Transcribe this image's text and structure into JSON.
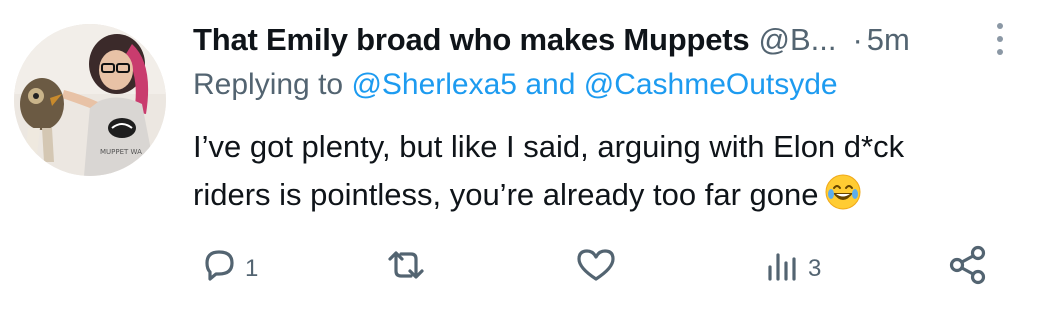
{
  "tweet": {
    "display_name": "That Emily broad who makes Muppets",
    "handle": "@B...",
    "separator": "·",
    "time": "5m",
    "replying_prefix": "Replying to",
    "mention_1": "@Sherlexa5",
    "replying_conjunction": "and",
    "mention_2": "@CashmeOutsyde",
    "body_line_1": "I’ve got plenty, but like I said, arguing with Elon d*ck",
    "body_line_2": "riders is pointless, you’re already too far gone",
    "emoji": "face-with-tears-of-joy",
    "avatar_shirt_text": "MUPPET WA"
  },
  "actions": {
    "reply_icon": "reply-bubble-icon",
    "reply_count": "1",
    "retweet_icon": "retweet-icon",
    "like_icon": "heart-icon",
    "views_icon": "views-bar-chart-icon",
    "views_count": "3",
    "share_icon": "share-icon"
  },
  "colors": {
    "text": "#0f1419",
    "secondary": "#536471",
    "link": "#1d9bf0",
    "background": "#ffffff"
  }
}
